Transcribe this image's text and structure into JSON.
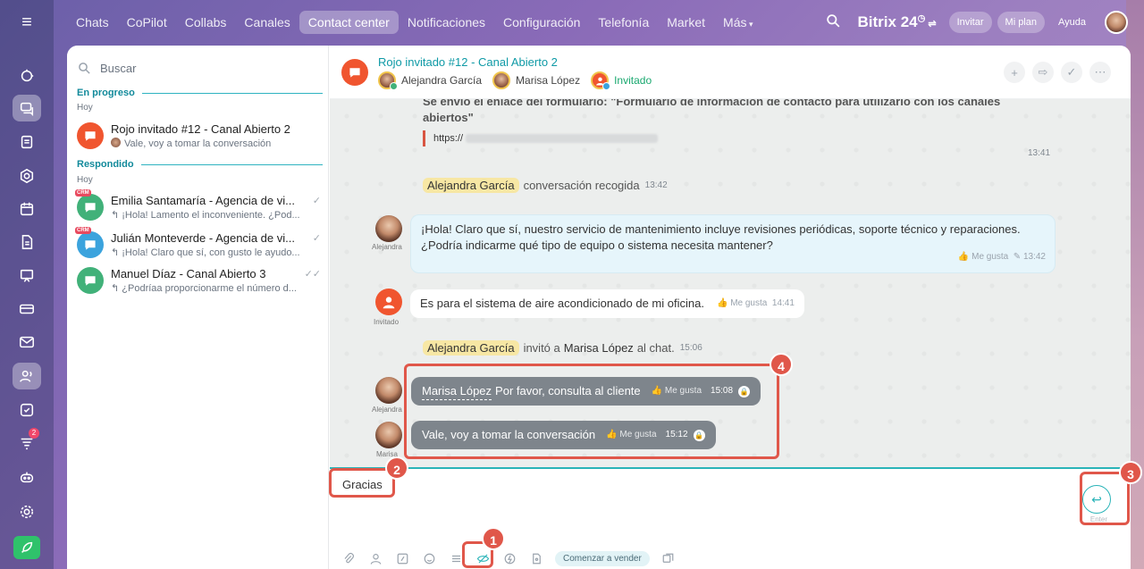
{
  "nav": {
    "items": [
      "Chats",
      "CoPilot",
      "Collabs",
      "Canales",
      "Contact center",
      "Notificaciones",
      "Configuración",
      "Telefonía",
      "Market",
      "Más"
    ],
    "active": "Contact center"
  },
  "topbar": {
    "brand": "Bitrix 24",
    "invite": "Invitar",
    "plan": "Mi plan",
    "help": "Ayuda"
  },
  "sidebar": {
    "badge": "2"
  },
  "list": {
    "search_placeholder": "Buscar",
    "section_progress": "En progreso",
    "day1": "Hoy",
    "section_answered": "Respondido",
    "day2": "Hoy",
    "chats": [
      {
        "title": "Rojo invitado #12 - Canal Abierto 2",
        "sub": "Vale, voy a tomar la conversación"
      },
      {
        "title": "Emilia Santamaría - Agencia de vi...",
        "sub": "↰ ¡Hola! Lamento el inconveniente. ¿Pod...",
        "crm": "CRM"
      },
      {
        "title": "Julián Monteverde - Agencia de vi...",
        "sub": "↰ ¡Hola! Claro que sí, con gusto le ayudo...",
        "crm": "CRM"
      },
      {
        "title": "Manuel Díaz - Canal Abierto 3",
        "sub": "↰ ¿Podríaa proporcionarme el número d..."
      }
    ]
  },
  "conv": {
    "title": "Rojo invitado #12 - Canal Abierto 2",
    "member1": "Alejandra García",
    "member2": "Marisa López",
    "member3": "Invitado"
  },
  "messages": {
    "sys_text": "Se envió el enlace del formulario: \"Formulario de información de contacto para utilizarlo con los canales abiertos\"",
    "link": "https://",
    "t1": "13:41",
    "pick_name": "Alejandra García",
    "pick_text": "conversación recogida",
    "pick_time": "13:42",
    "m1_line1": "¡Hola! Claro que sí, nuestro servicio de mantenimiento incluye revisiones periódicas, soporte técnico y reparaciones.",
    "m1_line2": "¿Podría indicarme qué tipo de equipo o sistema necesita mantener?",
    "m1_like": "Me gusta",
    "m1_time": "13:42",
    "lbl_alejandra": "Alejandra",
    "m2_text": "Es para el sistema de aire acondicionado de mi oficina.",
    "m2_like": "Me gusta",
    "m2_time": "14:41",
    "lbl_invitado": "Invitado",
    "inv_name": "Alejandra García",
    "inv_text": "invitó a",
    "inv_target": "Marisa López",
    "inv_rest": "al chat.",
    "inv_time": "15:06",
    "m3_mention": "Marisa López",
    "m3_text": "Por favor, consulta al cliente",
    "m3_like": "Me gusta",
    "m3_time": "15:08",
    "lbl_alejandra2": "Alejandra",
    "m4_text": "Vale, voy a tomar la conversación",
    "m4_like": "Me gusta",
    "m4_time": "15:12",
    "lbl_marisa": "Marisa"
  },
  "composer": {
    "text": "Gracias",
    "enter": "Enter",
    "sell": "Comenzar a vender"
  },
  "annotations": [
    "1",
    "2",
    "3",
    "4"
  ]
}
